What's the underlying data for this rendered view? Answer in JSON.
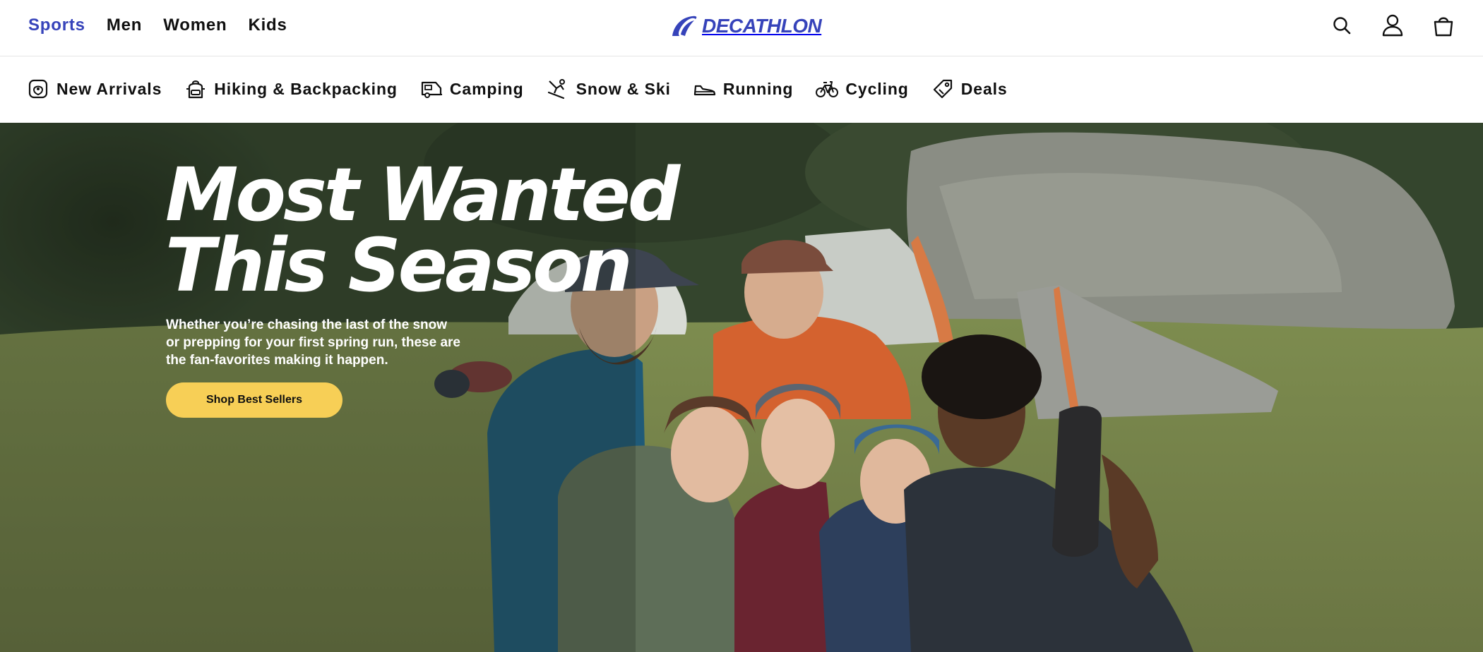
{
  "header": {
    "nav": [
      {
        "label": "Sports"
      },
      {
        "label": "Men"
      },
      {
        "label": "Women"
      },
      {
        "label": "Kids"
      }
    ],
    "logo_text": "DECATHLON",
    "icons": [
      "search-icon",
      "account-icon",
      "cart-icon"
    ]
  },
  "categories": [
    {
      "label": "New Arrivals",
      "icon": "new-arrivals-icon"
    },
    {
      "label": "Hiking & Backpacking",
      "icon": "backpack-icon"
    },
    {
      "label": "Camping",
      "icon": "camper-icon"
    },
    {
      "label": "Snow & Ski",
      "icon": "skier-icon"
    },
    {
      "label": "Running",
      "icon": "running-shoe-icon"
    },
    {
      "label": "Cycling",
      "icon": "bicycle-icon"
    },
    {
      "label": "Deals",
      "icon": "price-tag-icon"
    }
  ],
  "hero": {
    "title_line1": "Most Wanted",
    "title_line2": "This Season",
    "subtitle": "Whether you’re chasing the last of the snow or prepping for your first spring run, these are the fan-favorites making it happen.",
    "cta_label": "Shop Best Sellers"
  },
  "colors": {
    "brand": "#3643ba",
    "active_nav": "#3643ba",
    "cta": "#f7cf56"
  }
}
